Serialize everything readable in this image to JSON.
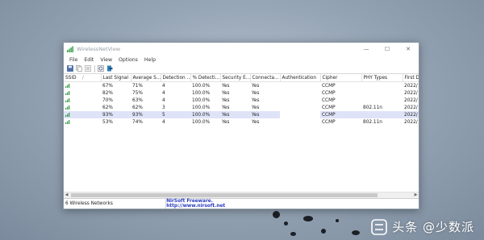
{
  "window": {
    "title": "WirelessNetView",
    "controls": {
      "minimize": "—",
      "maximize": "☐",
      "close": "✕"
    }
  },
  "menu": [
    "File",
    "Edit",
    "View",
    "Options",
    "Help"
  ],
  "toolbar": [
    "save-icon",
    "copy-icon",
    "properties-icon",
    "refresh-icon",
    "exit-icon"
  ],
  "columns": [
    "SSID",
    "Last Signal",
    "Average S...",
    "Detection ...",
    "% Detecti...",
    "Security E...",
    "Connecta...",
    "Authentication",
    "Cipher",
    "PHY Types",
    "First D"
  ],
  "sort_indicator": "/",
  "rows": [
    {
      "ssid": "",
      "last_signal": "67%",
      "avg_signal": "71%",
      "detection": "4",
      "pct_detection": "100.0%",
      "security": "Yes",
      "connectable": "Yes",
      "authentication": "",
      "cipher": "CCMP",
      "phy": "",
      "first_detection": "2022/"
    },
    {
      "ssid": "",
      "last_signal": "82%",
      "avg_signal": "75%",
      "detection": "4",
      "pct_detection": "100.0%",
      "security": "Yes",
      "connectable": "Yes",
      "authentication": "",
      "cipher": "CCMP",
      "phy": "",
      "first_detection": "2022/"
    },
    {
      "ssid": "",
      "last_signal": "70%",
      "avg_signal": "63%",
      "detection": "4",
      "pct_detection": "100.0%",
      "security": "Yes",
      "connectable": "Yes",
      "authentication": "",
      "cipher": "CCMP",
      "phy": "",
      "first_detection": "2022/"
    },
    {
      "ssid": "",
      "last_signal": "62%",
      "avg_signal": "62%",
      "detection": "3",
      "pct_detection": "100.0%",
      "security": "Yes",
      "connectable": "Yes",
      "authentication": "",
      "cipher": "CCMP",
      "phy": "802.11n",
      "first_detection": "2022/"
    },
    {
      "ssid": "",
      "last_signal": "93%",
      "avg_signal": "93%",
      "detection": "5",
      "pct_detection": "100.0%",
      "security": "Yes",
      "connectable": "Yes",
      "authentication": "",
      "cipher": "CCMP",
      "phy": "",
      "first_detection": "2022/",
      "selected": true
    },
    {
      "ssid": "",
      "last_signal": "53%",
      "avg_signal": "74%",
      "detection": "4",
      "pct_detection": "100.0%",
      "security": "Yes",
      "connectable": "Yes",
      "authentication": "",
      "cipher": "CCMP",
      "phy": "802.11n",
      "first_detection": "2022/"
    }
  ],
  "status": {
    "count_text": "6 Wireless Networks",
    "link_text": "NirSoft Freeware.  http://www.nirsoft.net"
  },
  "watermark": {
    "text": "头条 @少数派",
    "icon": "toutiao-logo-icon"
  },
  "colors": {
    "signal_icon": "#3aa04a",
    "selection": "#dfe3f8",
    "link": "#2b3fbf"
  }
}
